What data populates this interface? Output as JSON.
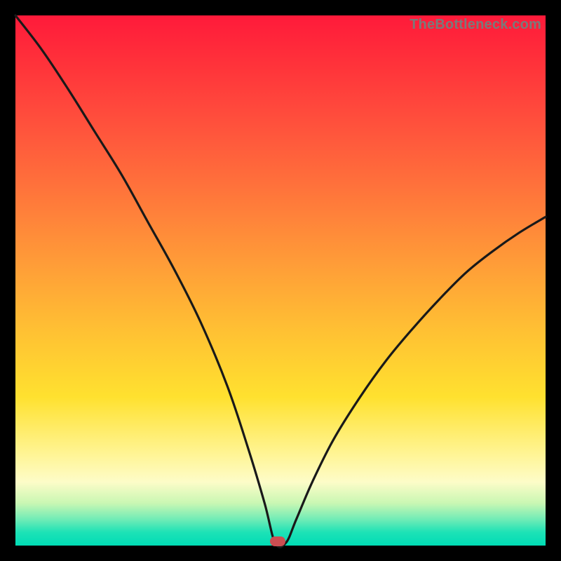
{
  "watermark": "TheBottleneck.com",
  "colors": {
    "page_bg": "#000000",
    "curve_stroke": "#191919",
    "marker_fill": "#cc4e52",
    "gradient_stops": [
      "#ff1a3a",
      "#ff2f3a",
      "#ff4a3c",
      "#ff713b",
      "#ff9a38",
      "#ffc233",
      "#ffe12f",
      "#fff597",
      "#fdfcc8",
      "#c9f7b3",
      "#72ecb6",
      "#1de2b6",
      "#00dcb5"
    ]
  },
  "chart_data": {
    "type": "line",
    "title": "",
    "xlabel": "",
    "ylabel": "",
    "xlim": [
      0,
      100
    ],
    "ylim": [
      0,
      100
    ],
    "grid": false,
    "legend": false,
    "annotations": [
      "TheBottleneck.com"
    ],
    "notes": "V-shaped bottleneck curve on a red→green vertical gradient. Curve starts near top-left, drops steeply to a minimum near x≈49 at y≈0, then rises with decreasing slope toward the right edge reaching ≈62% height.",
    "series": [
      {
        "name": "bottleneck-curve",
        "x": [
          0,
          5,
          10,
          15,
          20,
          25,
          30,
          35,
          40,
          44,
          47,
          49,
          51,
          53,
          56,
          60,
          65,
          70,
          75,
          80,
          85,
          90,
          95,
          100
        ],
        "y": [
          100,
          93.5,
          86,
          78,
          70,
          61,
          52,
          42,
          30,
          18,
          8,
          0.5,
          0.5,
          5,
          12,
          20,
          28,
          35,
          41,
          46.5,
          51.5,
          55.5,
          59,
          62
        ]
      }
    ],
    "marker": {
      "x": 49.5,
      "y": 0.8
    }
  }
}
